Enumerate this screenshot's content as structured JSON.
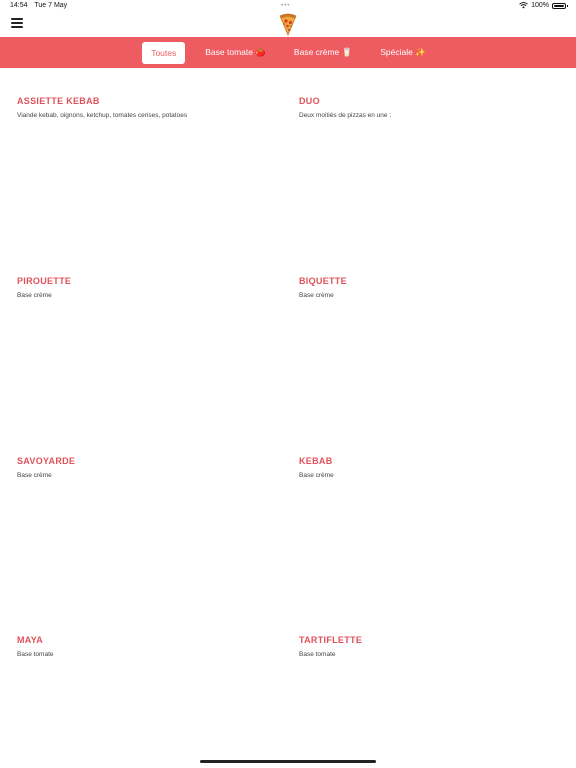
{
  "status_bar": {
    "time": "14:54",
    "date": "Tue 7 May",
    "battery": "100%",
    "dots": "•••"
  },
  "nav": {
    "menu_icon": "hamburger-menu-icon",
    "logo_icon": "pizza-slice-icon"
  },
  "categories": [
    {
      "label": "Toutes",
      "active": true
    },
    {
      "label": "Base tomate 🍅",
      "active": false
    },
    {
      "label": "Base crème 🥛",
      "active": false
    },
    {
      "label": "Spéciale ✨",
      "active": false
    }
  ],
  "colors": {
    "accent": "#ee5b60",
    "title": "#e0525a"
  },
  "items": [
    {
      "name": "ASSIETTE KEBAB",
      "description": "Viande kebab, oignons, ketchup, tomates cerises, potatoes"
    },
    {
      "name": "DUO",
      "description": "Deux moitiés de pizzas en une :"
    },
    {
      "name": "PIROUETTE",
      "description": "Base crème"
    },
    {
      "name": "BIQUETTE",
      "description": "Base crème"
    },
    {
      "name": "SAVOYARDE",
      "description": "Base crème"
    },
    {
      "name": "KEBAB",
      "description": "Base crème"
    },
    {
      "name": "MAYA",
      "description": "Base tomate"
    },
    {
      "name": "TARTIFLETTE",
      "description": "Base tomate"
    }
  ]
}
